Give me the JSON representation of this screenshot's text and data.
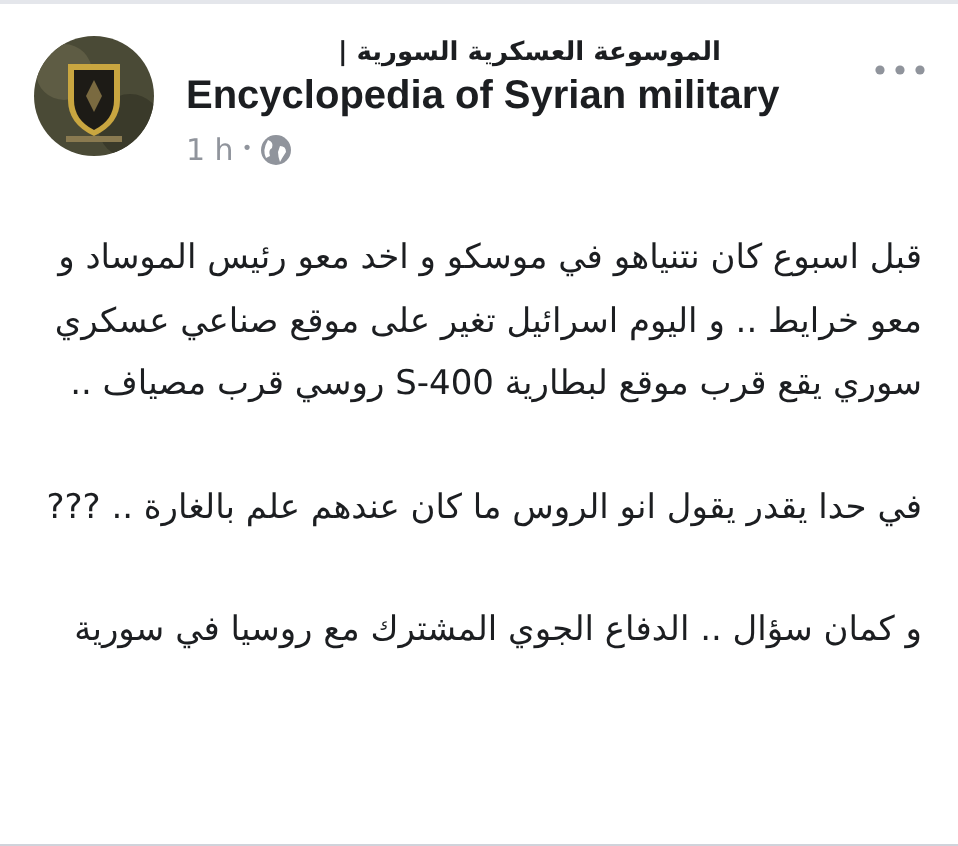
{
  "post": {
    "page_name_arabic": "الموسوعة العسكرية السورية |",
    "page_name": "Encyclopedia of Syrian military",
    "time": "1 h",
    "separator": "•",
    "paragraphs": [
      "قبل اسبوع كان نتنياهو في موسكو و اخد معو رئيس الموساد و معو خرايط .. و اليوم اسرائيل تغير على موقع صناعي عسكري سوري يقع قرب موقع لبطارية S-400 روسي قرب مصياف ..",
      "في حدا يقدر يقول انو الروس ما كان عندهم علم بالغارة .. ???",
      "و كمان سؤال .. الدفاع الجوي المشترك مع روسيا في سورية"
    ]
  }
}
